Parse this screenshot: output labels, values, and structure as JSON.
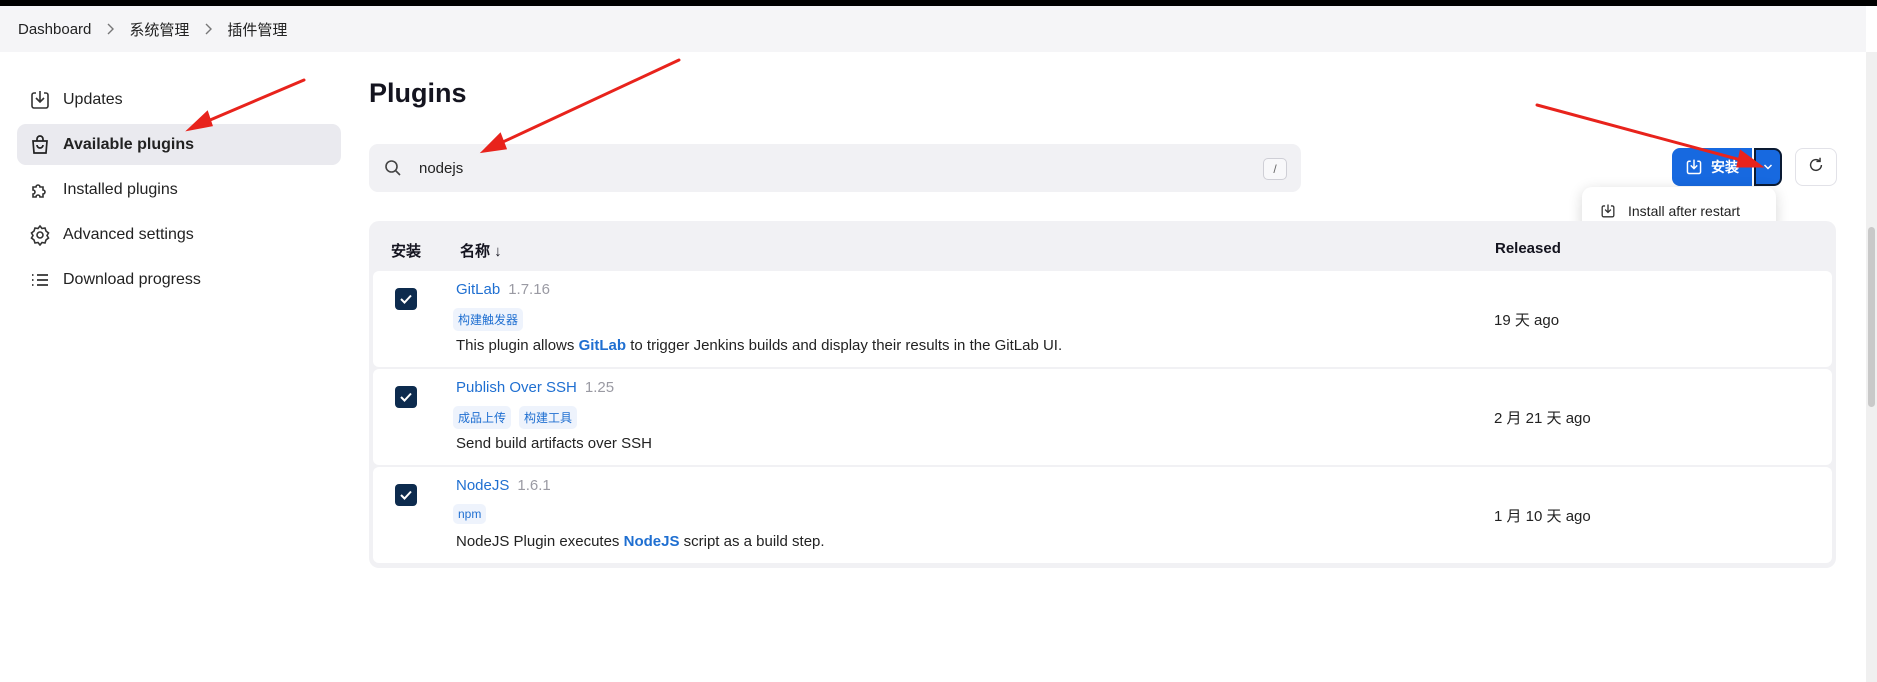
{
  "breadcrumb": {
    "items": [
      "Dashboard",
      "系统管理",
      "插件管理"
    ]
  },
  "sidebar": {
    "items": [
      {
        "label": "Updates",
        "icon": "download-icon",
        "active": false
      },
      {
        "label": "Available plugins",
        "icon": "shopping-bag-icon",
        "active": true
      },
      {
        "label": "Installed plugins",
        "icon": "puzzle-icon",
        "active": false
      },
      {
        "label": "Advanced settings",
        "icon": "gear-icon",
        "active": false
      },
      {
        "label": "Download progress",
        "icon": "list-icon",
        "active": false
      }
    ]
  },
  "main": {
    "title": "Plugins",
    "search": {
      "value": "nodejs",
      "shortcut": "/"
    },
    "install_button": {
      "label": "安装"
    },
    "dropdown": {
      "items": [
        "Install after restart"
      ]
    }
  },
  "table": {
    "headers": {
      "install": "安装",
      "name": "名称 ↓",
      "released": "Released"
    },
    "rows": [
      {
        "checked": true,
        "name": "GitLab",
        "version": "1.7.16",
        "tags": [
          "构建触发器"
        ],
        "desc_pre": "This plugin allows ",
        "desc_bold": "GitLab",
        "desc_post": " to trigger Jenkins builds and display their results in the GitLab UI.",
        "released": "19 天 ago"
      },
      {
        "checked": true,
        "name": "Publish Over SSH",
        "version": "1.25",
        "tags": [
          "成品上传",
          "构建工具"
        ],
        "desc_pre": "Send build artifacts over SSH",
        "desc_bold": "",
        "desc_post": "",
        "released": "2 月 21 天 ago"
      },
      {
        "checked": true,
        "name": "NodeJS",
        "version": "1.6.1",
        "tags": [
          "npm"
        ],
        "desc_pre": "NodeJS Plugin executes ",
        "desc_bold": "NodeJS",
        "desc_post": " script as a build step.",
        "released": "1 月 10 天 ago"
      }
    ]
  },
  "colors": {
    "accent": "#1769e0",
    "link": "#1f6fd1",
    "checkbox": "#0d2b4e",
    "annotation": "#e8231c"
  }
}
